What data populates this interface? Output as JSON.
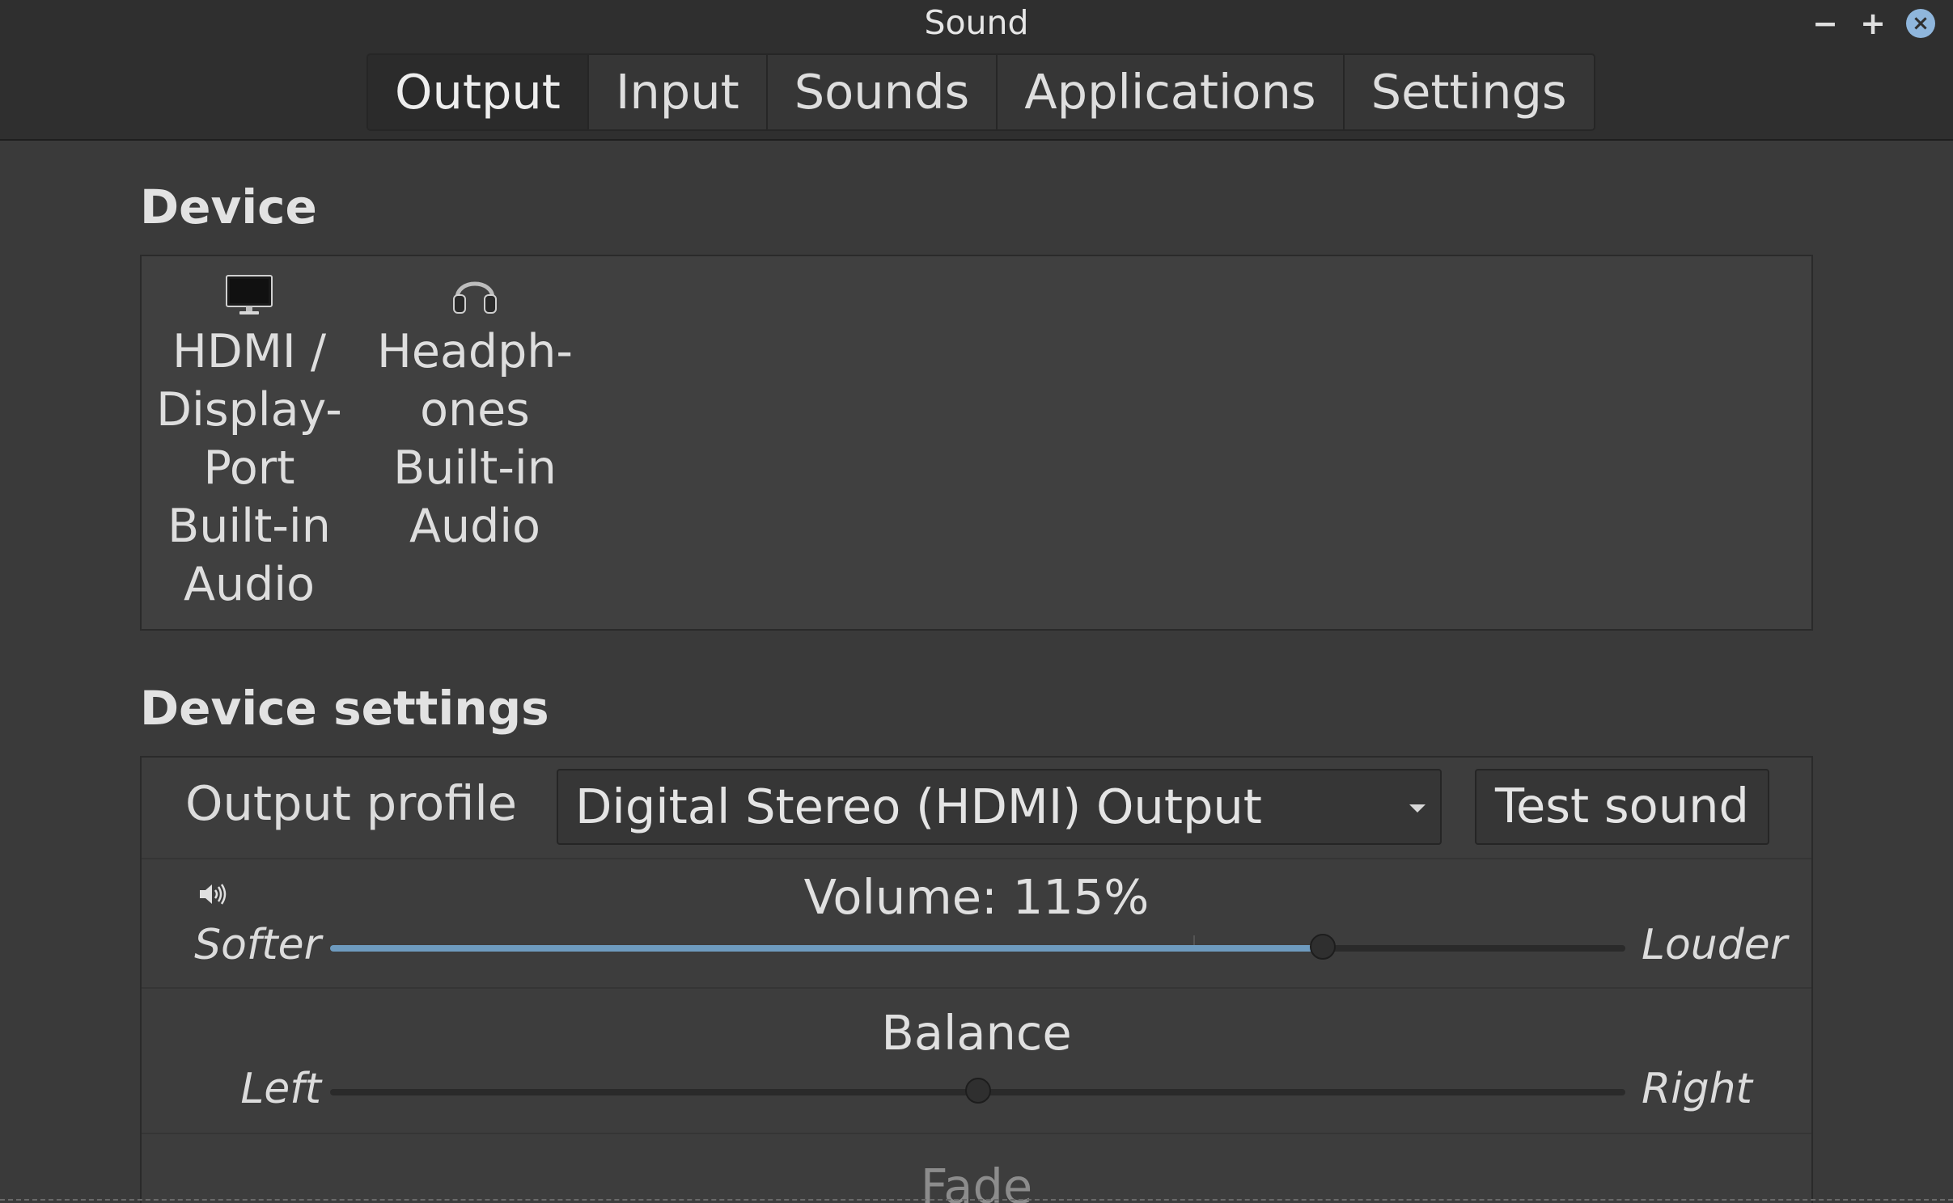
{
  "window": {
    "title": "Sound",
    "controls": {
      "minimize": "−",
      "maximize": "+",
      "close": "×"
    }
  },
  "tabs": [
    {
      "label": "Output",
      "active": true
    },
    {
      "label": "Input",
      "active": false
    },
    {
      "label": "Sounds",
      "active": false
    },
    {
      "label": "Applications",
      "active": false
    },
    {
      "label": "Settings",
      "active": false
    }
  ],
  "device_section": {
    "title": "Device",
    "devices": [
      {
        "label": "HDMI /\nDisplay-\nPort\nBuilt-in\nAudio",
        "icon": "monitor-icon",
        "selected": true
      },
      {
        "label": "Headph-\nones\nBuilt-in\nAudio",
        "icon": "headphones-icon",
        "selected": false
      }
    ]
  },
  "settings_section": {
    "title": "Device settings",
    "output_profile": {
      "label": "Output profile",
      "value": "Digital Stereo (HDMI) Output"
    },
    "test_button": "Test sound",
    "volume": {
      "title": "Volume: 115%",
      "icon": "speaker-icon",
      "left_label": "Softer",
      "right_label": "Louder",
      "value_percent": 115,
      "max_percent": 150,
      "mark_percent": 100
    },
    "balance": {
      "title": "Balance",
      "left_label": "Left",
      "right_label": "Right",
      "position_fraction": 0.5
    },
    "fade": {
      "title": "Fade"
    }
  },
  "colors": {
    "accent": "#6e9bbf",
    "background": "#3a3a3a",
    "header": "#2f2f2f",
    "close_button": "#8fb6dc"
  }
}
